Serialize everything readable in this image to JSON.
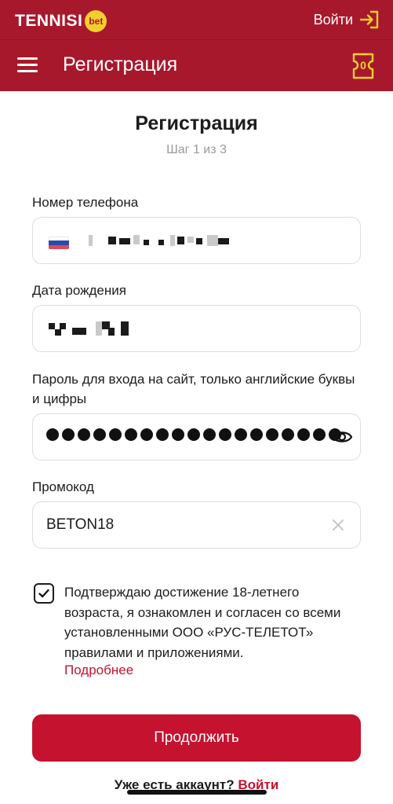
{
  "app": {
    "logo_text": "TENNISI",
    "logo_badge": "bet",
    "login_label": "Войти",
    "nav_title": "Регистрация",
    "bet_count": "0"
  },
  "form": {
    "title": "Регистрация",
    "step": "Шаг 1 из 3",
    "phone": {
      "label": "Номер телефона"
    },
    "birthdate": {
      "label": "Дата рождения"
    },
    "password": {
      "label": "Пароль для входа на сайт, только английские буквы и цифры",
      "dot_count": 19
    },
    "promo": {
      "label": "Промокод",
      "value": "BETON18"
    },
    "agreement": {
      "checked": true,
      "text": "Подтверждаю достижение 18-летнего возраста, я ознакомлен и согласен со всеми установленными ООО «РУС-ТЕЛЕТОТ» правилами и приложениями.",
      "more_link": "Подробнее"
    },
    "submit_label": "Продолжить",
    "have_account": "Уже есть аккаунт?",
    "login_link": "Войти"
  },
  "colors": {
    "header": "#a8182c",
    "accent": "#c4122f",
    "badge": "#f2cf2e"
  },
  "icons": [
    "hamburger-menu-icon",
    "login-arrow-icon",
    "bet-slip-icon",
    "russia-flag-icon",
    "eye-icon",
    "clear-icon",
    "checkmark-icon"
  ]
}
